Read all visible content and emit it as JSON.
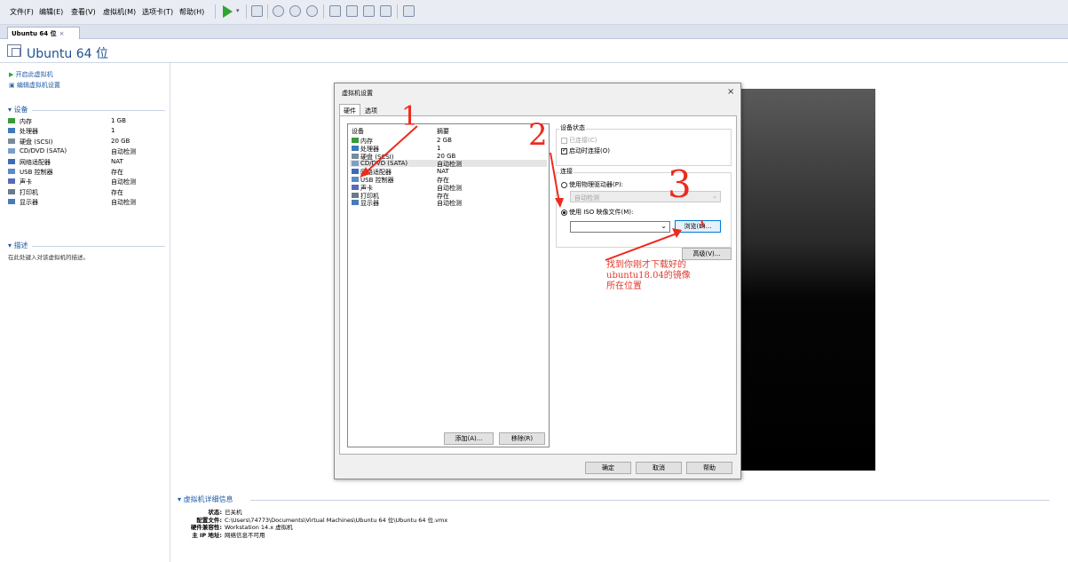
{
  "menu": [
    "文件(F)",
    "编辑(E)",
    "查看(V)",
    "虚拟机(M)",
    "选项卡(T)",
    "帮助(H)"
  ],
  "tab": {
    "label": "Ubuntu 64 位",
    "close": "×"
  },
  "vm_title": "Ubuntu 64 位",
  "actions": {
    "power_on": "开启此虚拟机",
    "edit_settings": "编辑虚拟机设置"
  },
  "devices_section": "设备",
  "devices": [
    {
      "name": "内存",
      "value": "1 GB",
      "icon": "memory-icon"
    },
    {
      "name": "处理器",
      "value": "1",
      "icon": "cpu-icon"
    },
    {
      "name": "硬盘 (SCSI)",
      "value": "20 GB",
      "icon": "disk-icon"
    },
    {
      "name": "CD/DVD (SATA)",
      "value": "自动检测",
      "icon": "cdrom-icon"
    },
    {
      "name": "网络适配器",
      "value": "NAT",
      "icon": "network-icon"
    },
    {
      "name": "USB 控制器",
      "value": "存在",
      "icon": "usb-icon"
    },
    {
      "name": "声卡",
      "value": "自动检测",
      "icon": "sound-icon"
    },
    {
      "name": "打印机",
      "value": "存在",
      "icon": "printer-icon"
    },
    {
      "name": "显示器",
      "value": "自动检测",
      "icon": "display-icon"
    }
  ],
  "description_section": "描述",
  "description_placeholder": "在此处键入对该虚拟机的描述。",
  "dialog": {
    "title": "虚拟机设置",
    "close": "×",
    "tabs": [
      "硬件",
      "选项"
    ],
    "list_headers": {
      "device": "设备",
      "summary": "摘要"
    },
    "hardware": [
      {
        "name": "内存",
        "value": "2 GB"
      },
      {
        "name": "处理器",
        "value": "1"
      },
      {
        "name": "硬盘 (SCSI)",
        "value": "20 GB"
      },
      {
        "name": "CD/DVD (SATA)",
        "value": "自动检测"
      },
      {
        "name": "网络适配器",
        "value": "NAT"
      },
      {
        "name": "USB 控制器",
        "value": "存在"
      },
      {
        "name": "声卡",
        "value": "自动检测"
      },
      {
        "name": "打印机",
        "value": "存在"
      },
      {
        "name": "显示器",
        "value": "自动检测"
      }
    ],
    "selected_index": 3,
    "add_button": "添加(A)...",
    "remove_button": "移除(R)",
    "device_status": {
      "label": "设备状态",
      "connected": "已连接(C)",
      "connect_on_power": "启动时连接(O)"
    },
    "connection": {
      "label": "连接",
      "physical": "使用物理驱动器(P):",
      "physical_value": "自动检测",
      "iso": "使用 ISO 映像文件(M):",
      "iso_value": "",
      "browse": "浏览(B)..."
    },
    "advanced": "高级(V)...",
    "ok": "确定",
    "cancel": "取消",
    "help": "帮助"
  },
  "details_section": "虚拟机详细信息",
  "details": [
    {
      "key": "状态:",
      "value": "已关机"
    },
    {
      "key": "配置文件:",
      "value": "C:\\Users\\74773\\Documents\\Virtual Machines\\Ubuntu 64 位\\Ubuntu 64 位.vmx"
    },
    {
      "key": "硬件兼容性:",
      "value": "Workstation 14.x 虚拟机"
    },
    {
      "key": "主 IP 地址:",
      "value": "网络信息不可用"
    }
  ],
  "annotations": {
    "n1": "1",
    "n2": "2",
    "n3": "3",
    "note": [
      "找到你刚才下载好的",
      "ubuntu18.04的镜像",
      "所在位置"
    ]
  },
  "colors": {
    "link": "#1c5aa6",
    "annotation": "#ee2a1e",
    "play": "#2fa52f"
  }
}
